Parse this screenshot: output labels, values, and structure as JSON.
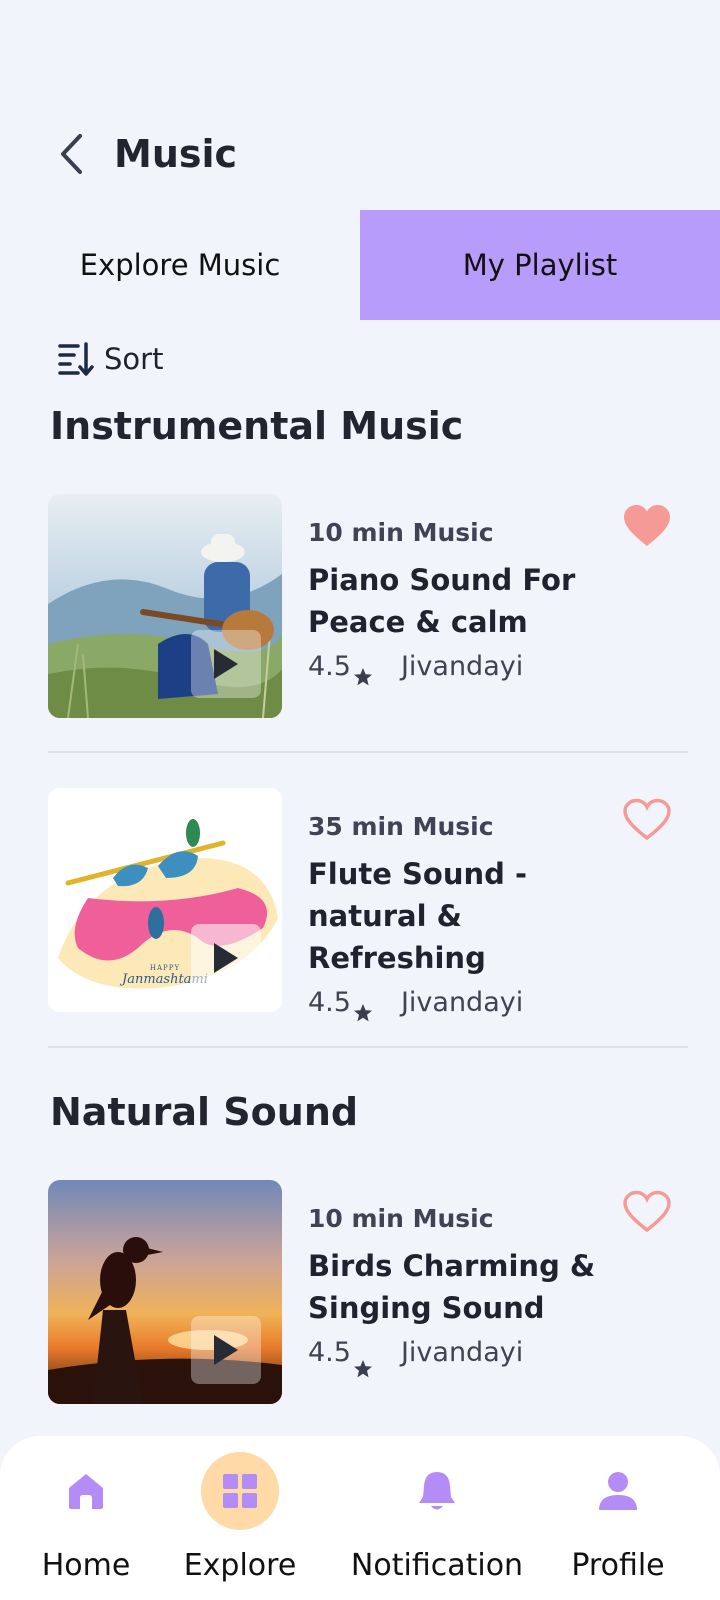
{
  "header": {
    "title": "Music"
  },
  "tabs": [
    {
      "label": "Explore Music"
    },
    {
      "label": "My Playlist"
    }
  ],
  "sort": {
    "label": "Sort"
  },
  "sections": [
    {
      "title": "Instrumental Music",
      "items": [
        {
          "duration": "10 min Music",
          "title": "Piano Sound For Peace & calm",
          "rating": "4.5",
          "author": "Jivandayi",
          "favorite": true
        },
        {
          "duration": "35 min Music",
          "title": "Flute Sound - natural & Refreshing",
          "rating": "4.5",
          "author": "Jivandayi",
          "favorite": false,
          "image_text_small": "HAPPY",
          "image_text": "Janmashtami"
        }
      ]
    },
    {
      "title": "Natural Sound",
      "items": [
        {
          "duration": "10 min Music",
          "title": "Birds Charming & Singing Sound",
          "rating": "4.5",
          "author": "Jivandayi",
          "favorite": false
        }
      ]
    }
  ],
  "bottom_nav": [
    {
      "label": "Home",
      "icon": "home-icon",
      "active": false
    },
    {
      "label": "Explore",
      "icon": "grid-icon",
      "active": true
    },
    {
      "label": "Notification",
      "icon": "bell-icon",
      "active": false
    },
    {
      "label": "Profile",
      "icon": "user-icon",
      "active": false
    }
  ],
  "colors": {
    "accent": "#b89cfb",
    "heart": "#f69a96",
    "nav_active_bg": "#ffd9a6",
    "nav_icon": "#b48cf5"
  }
}
